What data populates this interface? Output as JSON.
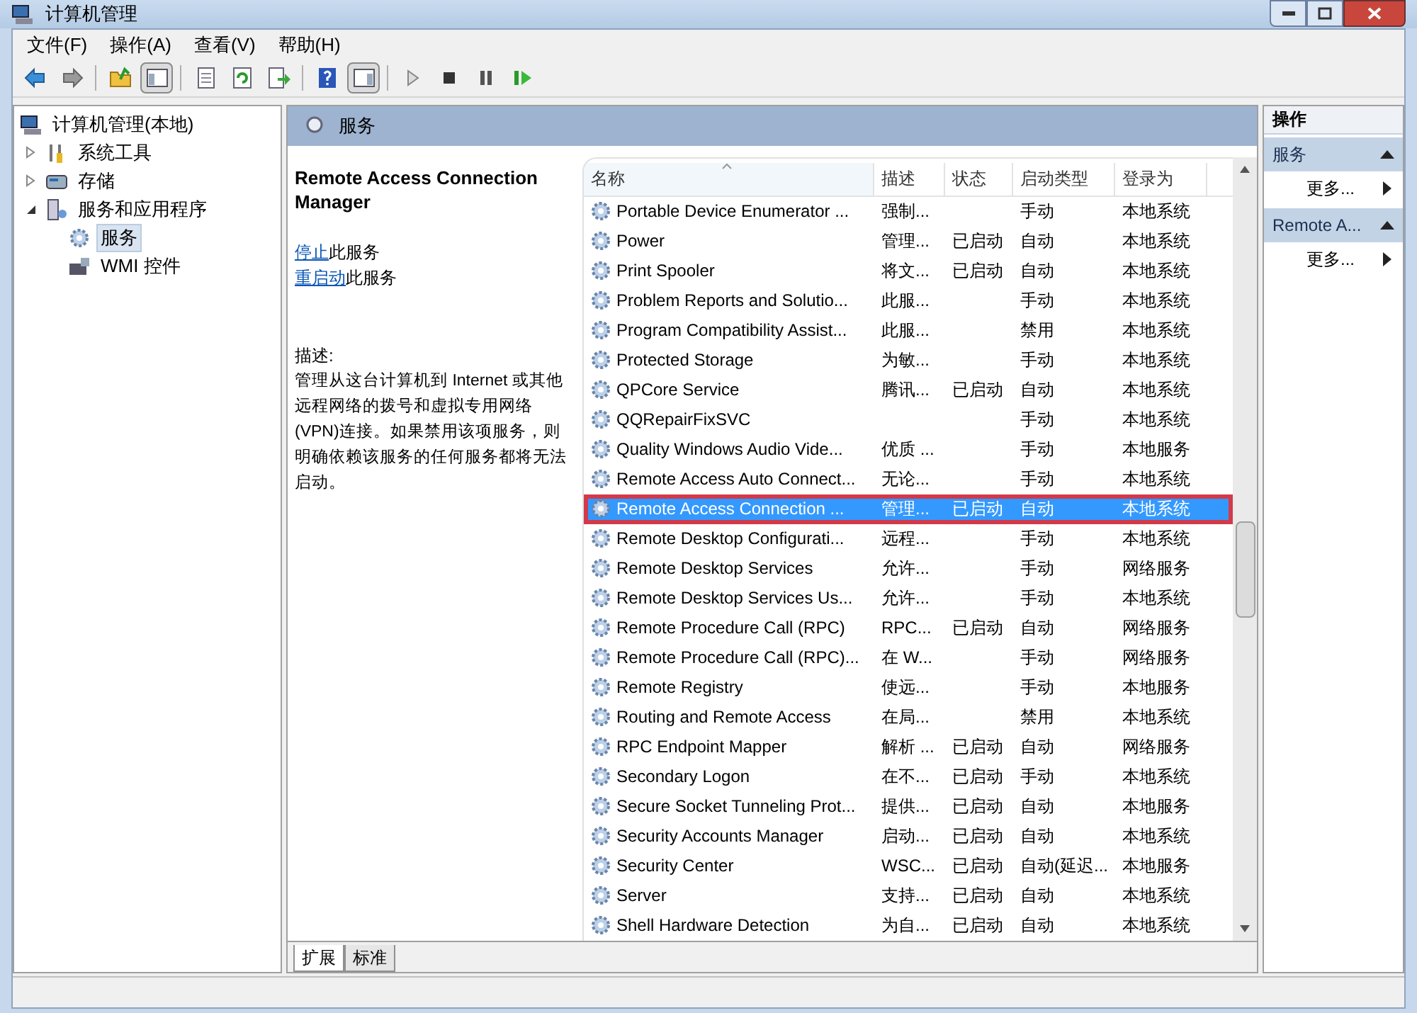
{
  "window": {
    "title": "计算机管理"
  },
  "menu": [
    "文件(F)",
    "操作(A)",
    "查看(V)",
    "帮助(H)"
  ],
  "toolbar": [
    {
      "kind": "back"
    },
    {
      "kind": "forward"
    },
    {
      "kind": "sep"
    },
    {
      "kind": "up"
    },
    {
      "kind": "tree",
      "selected": true
    },
    {
      "kind": "sep"
    },
    {
      "kind": "props"
    },
    {
      "kind": "refresh"
    },
    {
      "kind": "export"
    },
    {
      "kind": "sep"
    },
    {
      "kind": "help"
    },
    {
      "kind": "pane",
      "selected": true
    },
    {
      "kind": "sep"
    },
    {
      "kind": "play"
    },
    {
      "kind": "stop"
    },
    {
      "kind": "pause"
    },
    {
      "kind": "resume"
    }
  ],
  "tree": [
    {
      "label": "计算机管理(本地)",
      "selected": false,
      "children": [
        {
          "label": "系统工具",
          "expanded": false,
          "selected": false
        },
        {
          "label": "存储",
          "expanded": false,
          "selected": false
        },
        {
          "label": "服务和应用程序",
          "expanded": true,
          "selected": false,
          "children": [
            {
              "label": "服务",
              "selected": true
            },
            {
              "label": "WMI 控件",
              "selected": false
            }
          ]
        }
      ]
    }
  ],
  "panel_header": "服务",
  "detail": {
    "title": "Remote Access Connection Manager",
    "actions": [
      {
        "link": "停止",
        "text": "此服务"
      },
      {
        "link": "重启动",
        "text": "此服务"
      }
    ],
    "description_label": "描述:",
    "description": "管理从这台计算机到 Internet 或其他远程网络的拨号和虚拟专用网络(VPN)连接。如果禁用该项服务，则明确依赖该服务的任何服务都将无法启动。"
  },
  "table": {
    "columns": [
      "名称",
      "描述",
      "状态",
      "启动类型",
      "登录为"
    ],
    "rows": [
      {
        "cells": [
          "Portable Device Enumerator ...",
          "强制...",
          "",
          "手动",
          "本地系统"
        ],
        "selected": false
      },
      {
        "cells": [
          "Power",
          "管理...",
          "已启动",
          "自动",
          "本地系统"
        ],
        "selected": false
      },
      {
        "cells": [
          "Print Spooler",
          "将文...",
          "已启动",
          "自动",
          "本地系统"
        ],
        "selected": false
      },
      {
        "cells": [
          "Problem Reports and Solutio...",
          "此服...",
          "",
          "手动",
          "本地系统"
        ],
        "selected": false
      },
      {
        "cells": [
          "Program Compatibility Assist...",
          "此服...",
          "",
          "禁用",
          "本地系统"
        ],
        "selected": false
      },
      {
        "cells": [
          "Protected Storage",
          "为敏...",
          "",
          "手动",
          "本地系统"
        ],
        "selected": false
      },
      {
        "cells": [
          "QPCore Service",
          "腾讯...",
          "已启动",
          "自动",
          "本地系统"
        ],
        "selected": false
      },
      {
        "cells": [
          "QQRepairFixSVC",
          "",
          "",
          "手动",
          "本地系统"
        ],
        "selected": false
      },
      {
        "cells": [
          "Quality Windows Audio Vide...",
          "优质 ...",
          "",
          "手动",
          "本地服务"
        ],
        "selected": false
      },
      {
        "cells": [
          "Remote Access Auto Connect...",
          "无论...",
          "",
          "手动",
          "本地系统"
        ],
        "selected": false
      },
      {
        "cells": [
          "Remote Access Connection ...",
          "管理...",
          "已启动",
          "自动",
          "本地系统"
        ],
        "selected": true
      },
      {
        "cells": [
          "Remote Desktop Configurati...",
          "远程...",
          "",
          "手动",
          "本地系统"
        ],
        "selected": false
      },
      {
        "cells": [
          "Remote Desktop Services",
          "允许...",
          "",
          "手动",
          "网络服务"
        ],
        "selected": false
      },
      {
        "cells": [
          "Remote Desktop Services Us...",
          "允许...",
          "",
          "手动",
          "本地系统"
        ],
        "selected": false
      },
      {
        "cells": [
          "Remote Procedure Call (RPC)",
          "RPC...",
          "已启动",
          "自动",
          "网络服务"
        ],
        "selected": false
      },
      {
        "cells": [
          "Remote Procedure Call (RPC)...",
          "在 W...",
          "",
          "手动",
          "网络服务"
        ],
        "selected": false
      },
      {
        "cells": [
          "Remote Registry",
          "使远...",
          "",
          "手动",
          "本地服务"
        ],
        "selected": false
      },
      {
        "cells": [
          "Routing and Remote Access",
          "在局...",
          "",
          "禁用",
          "本地系统"
        ],
        "selected": false
      },
      {
        "cells": [
          "RPC Endpoint Mapper",
          "解析 ...",
          "已启动",
          "自动",
          "网络服务"
        ],
        "selected": false
      },
      {
        "cells": [
          "Secondary Logon",
          "在不...",
          "已启动",
          "手动",
          "本地系统"
        ],
        "selected": false
      },
      {
        "cells": [
          "Secure Socket Tunneling Prot...",
          "提供...",
          "已启动",
          "自动",
          "本地服务"
        ],
        "selected": false
      },
      {
        "cells": [
          "Security Accounts Manager",
          "启动...",
          "已启动",
          "自动",
          "本地系统"
        ],
        "selected": false
      },
      {
        "cells": [
          "Security Center",
          "WSC...",
          "已启动",
          "自动(延迟...",
          "本地服务"
        ],
        "selected": false
      },
      {
        "cells": [
          "Server",
          "支持...",
          "已启动",
          "自动",
          "本地系统"
        ],
        "selected": false
      },
      {
        "cells": [
          "Shell Hardware Detection",
          "为自...",
          "已启动",
          "自动",
          "本地系统"
        ],
        "selected": false
      }
    ]
  },
  "bottom_tabs": [
    {
      "label": "扩展",
      "selected": true
    },
    {
      "label": "标准",
      "selected": false
    }
  ],
  "actions_pane": {
    "title": "操作",
    "sections": [
      {
        "title": "服务",
        "expanded": true,
        "items": [
          "更多..."
        ]
      },
      {
        "title": "Remote A...",
        "expanded": true,
        "items": [
          "更多..."
        ]
      }
    ]
  }
}
